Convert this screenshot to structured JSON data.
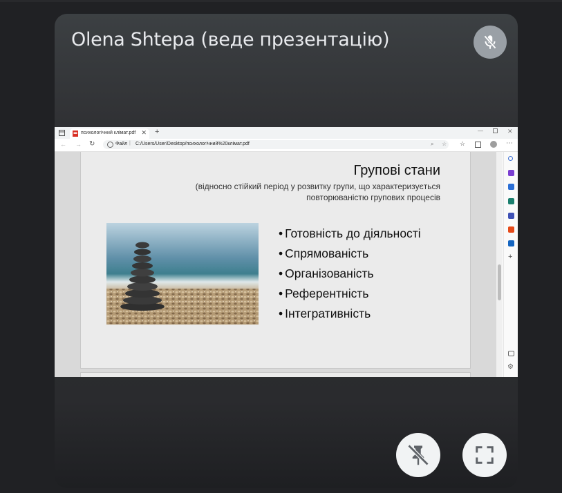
{
  "tile": {
    "presenter_label": "Olena Shtepa (веде презентацію)"
  },
  "browser": {
    "tab_title": "психологічний клімат.pdf",
    "url_prefix": "Файл",
    "url": "C:/Users/User/Desktop/психологічний%20клімат.pdf"
  },
  "slide": {
    "title": "Групові стани",
    "subtitle": "(відносно стійкий період у розвитку групи, що характеризується повторюваністю групових процесів",
    "bullets": [
      "Готовність до діяльності",
      "Спрямованість",
      "Організованість",
      "Референтність",
      "Інтегративність"
    ]
  },
  "icons": {
    "mic": "mic-off-icon",
    "pin": "unpin-icon",
    "fullscreen": "fullscreen-icon"
  },
  "colors": {
    "background": "#202124",
    "tile": "#303134",
    "button": "#f1f3f4",
    "mic_button": "#9aa0a6"
  }
}
